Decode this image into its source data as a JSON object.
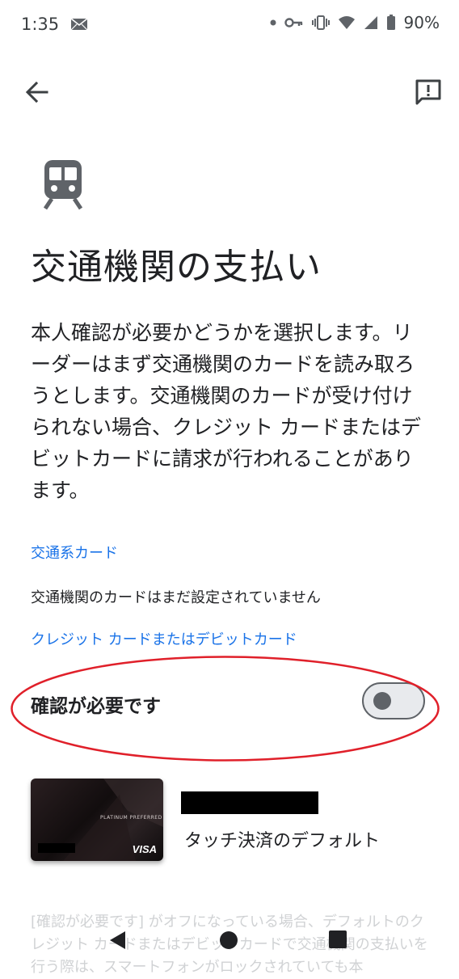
{
  "status_bar": {
    "time": "1:35",
    "battery_text": "90%",
    "icons": [
      "mail-icon",
      "dot-icon",
      "key-icon",
      "vibrate-icon",
      "wifi-icon",
      "signal-icon",
      "battery-icon"
    ]
  },
  "app_bar": {
    "back_icon": "arrow-left-icon",
    "feedback_icon": "feedback-icon"
  },
  "page": {
    "icon": "train-icon",
    "title": "交通機関の支払い",
    "description": "本人確認が必要かどうかを選択します。リーダーはまず交通機関のカードを読み取ろうとします。交通機関のカードが受け付けられない場合、クレジット カードまたはデビットカードに請求が行われることがあります。"
  },
  "transit_section": {
    "label": "交通系カード",
    "empty_text": "交通機関のカードはまだ設定されていません"
  },
  "credit_section": {
    "label": "クレジット カードまたはデビットカード",
    "require_verification_label": "確認が必要です",
    "toggle_on": false
  },
  "card": {
    "brand_text": "PLATINUM PREFERRED",
    "network": "VISA",
    "default_text": "タッチ決済のデフォルト"
  },
  "footer_note": "[確認が必要です] がオフになっている場合、デフォルトのクレジット カードまたはデビットカードで交通機関の支払いを行う際は、スマートフォンがロックされていても本",
  "colors": {
    "accent": "#1a73e8",
    "annotation": "#e0202a",
    "text": "#202124"
  }
}
